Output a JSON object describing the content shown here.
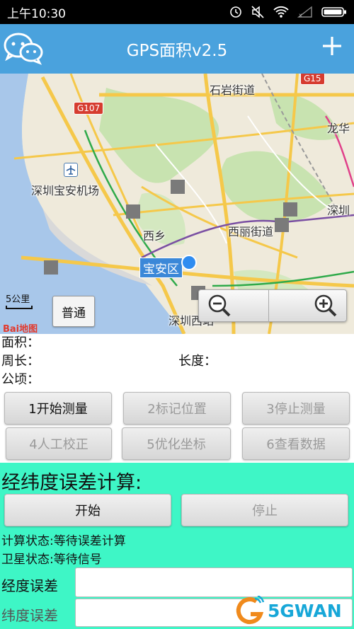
{
  "status_bar": {
    "time": "上午10:30",
    "icons": [
      "alarm-icon",
      "mute-icon",
      "wifi-icon",
      "signal-icon",
      "battery-icon"
    ]
  },
  "app_bar": {
    "title": "GPS面积v2.5",
    "logo_icon": "wechat-icon",
    "action_icon": "plus-icon",
    "background": "#4aa2dd"
  },
  "map": {
    "labels": {
      "shiyan": "石岩街道",
      "longhua": "龙华",
      "airport": "深圳宝安机场",
      "shenzhen": "深圳",
      "xixiang": "西乡",
      "xili": "西丽街道",
      "shenzhen_west": "深圳西站",
      "baoan": "宝安区"
    },
    "road_signs": {
      "g107": "G107",
      "g15": "G15"
    },
    "scale": "5公里",
    "logo": "Bai地图",
    "mode_button": "普通",
    "zoom_out_icon": "zoom-out-icon",
    "zoom_in_icon": "zoom-in-icon"
  },
  "info": {
    "area": "面积：",
    "perimeter": "周长：",
    "length": "长度：",
    "hectare": "公顷："
  },
  "buttons": [
    {
      "label": "1开始测量",
      "enabled": true
    },
    {
      "label": "2标记位置",
      "enabled": false
    },
    {
      "label": "3停止测量",
      "enabled": false
    },
    {
      "label": "4人工校正",
      "enabled": false
    },
    {
      "label": "5优化坐标",
      "enabled": false
    },
    {
      "label": "6查看数据",
      "enabled": false
    }
  ],
  "error_panel": {
    "heading": "经纬度误差计算:",
    "start": "开始",
    "stop": "停止",
    "calc_status": "计算状态:等待误差计算",
    "satellite_status": "卫星状态:等待信号",
    "longitude_error_label": "经度误差",
    "latitude_error_label": "纬度误差",
    "longitude_error_value": "",
    "latitude_error_value": "",
    "background": "#3ef6c6"
  },
  "watermark": "5GWAN"
}
